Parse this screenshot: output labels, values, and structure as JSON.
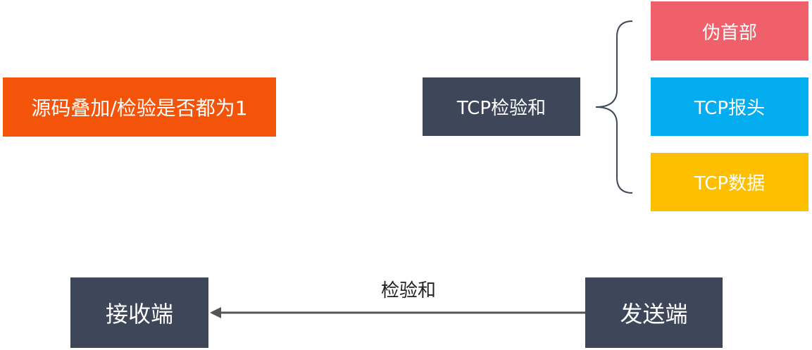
{
  "colors": {
    "dark": "#3d4759",
    "orange": "#f4540a",
    "pink": "#f0606a",
    "blue": "#04adef",
    "yellow": "#fdbf00",
    "line": "#3d4759",
    "arrow": "#555555"
  },
  "verify_box": {
    "label": "源码叠加/检验是否都为1"
  },
  "checksum_box": {
    "label": "TCP检验和"
  },
  "components": [
    {
      "label": "伪首部"
    },
    {
      "label": "TCP报头"
    },
    {
      "label": "TCP数据"
    }
  ],
  "flow": {
    "receiver": "接收端",
    "sender": "发送端",
    "arrow_label": "检验和"
  }
}
